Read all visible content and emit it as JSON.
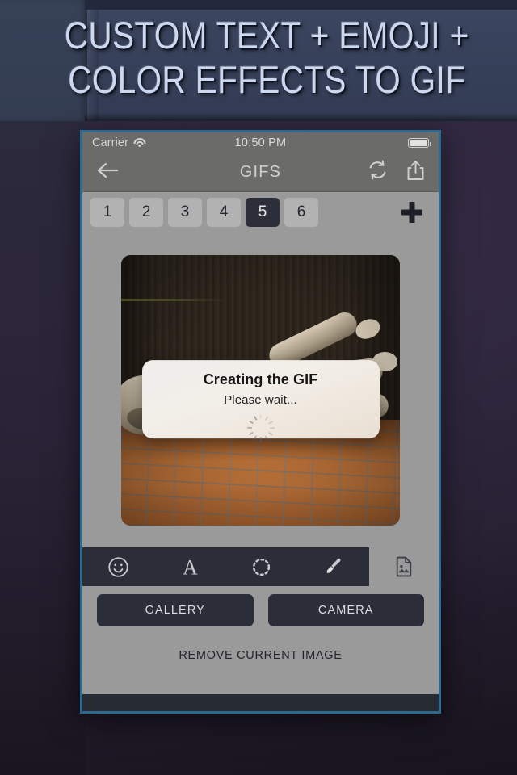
{
  "promo": {
    "headline": "CUSTOM TEXT + EMOJI +\nCOLOR EFFECTS TO  GIF",
    "text_color": "#ccd8ef",
    "background_color": "#37415a"
  },
  "status_bar": {
    "carrier": "Carrier",
    "wifi_icon": "wifi-icon",
    "time": "10:50 PM",
    "battery_icon": "battery-icon"
  },
  "nav_bar": {
    "back_icon": "back-arrow-icon",
    "title": "GIFS",
    "refresh_icon": "refresh-icon",
    "share_icon": "share-upload-icon"
  },
  "tabs": {
    "items": [
      {
        "label": "1",
        "active": false
      },
      {
        "label": "2",
        "active": false
      },
      {
        "label": "3",
        "active": false
      },
      {
        "label": "4",
        "active": false
      },
      {
        "label": "5",
        "active": true
      },
      {
        "label": "6",
        "active": false
      }
    ],
    "add_icon": "plus-icon",
    "active_background": "#2c2f39",
    "inactive_background": "#b2b2b2"
  },
  "canvas": {
    "image_description": "dog lying on back on orange brick floor"
  },
  "modal": {
    "title": "Creating the GIF",
    "subtitle": "Please wait...",
    "spinner_icon": "loading-spinner-icon"
  },
  "toolbar": {
    "tools": [
      {
        "icon": "smiley-emoji-icon",
        "label": "Emoji"
      },
      {
        "icon": "letter-a-text-icon",
        "label": "Text"
      },
      {
        "icon": "dashed-circle-frame-icon",
        "label": "Frame"
      },
      {
        "icon": "paintbrush-icon",
        "label": "Brush"
      }
    ],
    "image_icon": "image-file-icon",
    "background": "#2b2e38"
  },
  "actions": {
    "gallery_label": "GALLERY",
    "camera_label": "CAMERA",
    "remove_label": "REMOVE CURRENT IMAGE"
  }
}
